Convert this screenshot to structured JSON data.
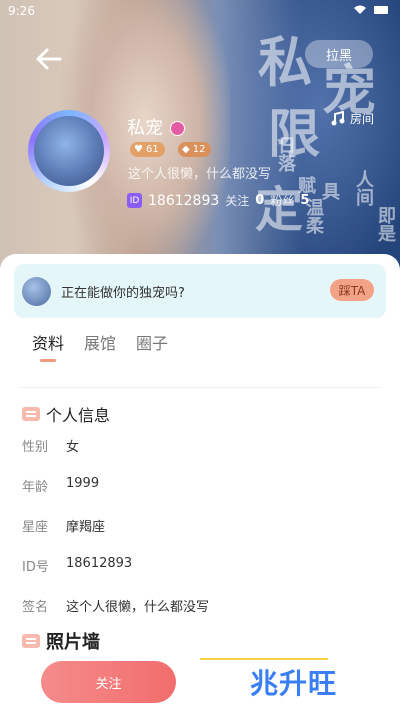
{
  "status": {
    "time": "9:26"
  },
  "header": {
    "block_label": "拉黑",
    "room_label": "房间"
  },
  "deco_text": [
    "私",
    "宠",
    "限",
    "定",
    "日落",
    "赋",
    "具",
    "温柔",
    "人间",
    "即是"
  ],
  "profile": {
    "name": "私宠",
    "badges": [
      "61",
      "12"
    ],
    "bio": "这个人很懒，什么都没写",
    "id_label": "ID",
    "id_number": "18612893",
    "follow_label": "关注",
    "follow_count": "0",
    "fans_label": "粉丝",
    "fans_count": "5"
  },
  "notice": {
    "text": "正在能做你的独宠吗?",
    "button": "踩TA"
  },
  "tabs": [
    "资料",
    "展馆",
    "圈子"
  ],
  "personal_info": {
    "title": "个人信息",
    "rows": [
      {
        "label": "性别",
        "value": "女"
      },
      {
        "label": "年龄",
        "value": "1999"
      },
      {
        "label": "星座",
        "value": "摩羯座"
      },
      {
        "label": "ID号",
        "value": "18612893"
      },
      {
        "label": "签名",
        "value": "这个人很懒，什么都没写"
      }
    ]
  },
  "photo_wall": {
    "title": "照片墙"
  },
  "bottom": {
    "follow_button": "关注"
  },
  "watermark": "兆升旺",
  "colors": {
    "accent": "#f26d6d",
    "notice_bg": "#e5f6f8",
    "tab_underline": "#f29a7a"
  }
}
